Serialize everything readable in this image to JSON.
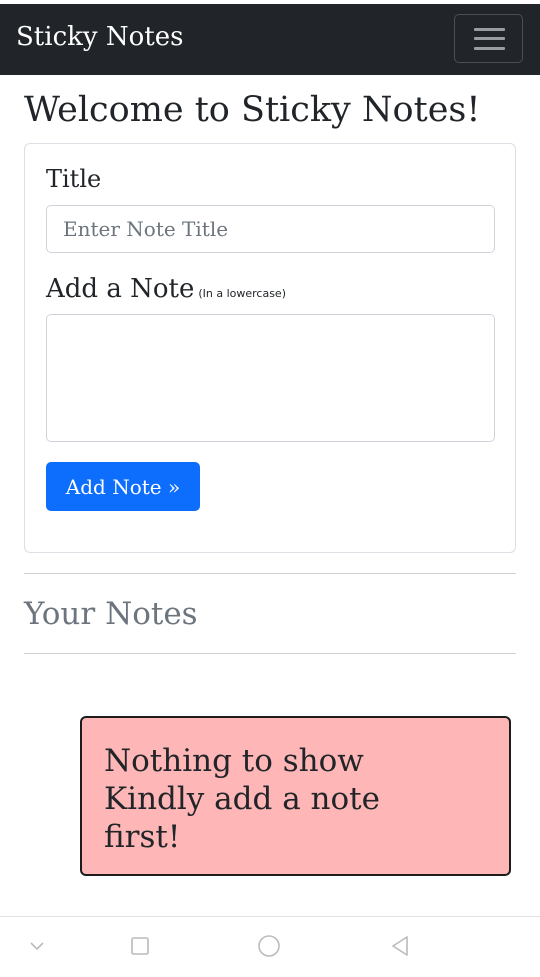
{
  "navbar": {
    "brand": "Sticky Notes"
  },
  "page": {
    "title": "Welcome to Sticky Notes!"
  },
  "form": {
    "title_label": "Title",
    "title_placeholder": "Enter Note Title",
    "title_value": "",
    "note_label": "Add a Note",
    "note_hint": "(In a lowercase)",
    "note_value": "",
    "add_button": "Add Note »"
  },
  "notes": {
    "heading": "Your Notes",
    "empty_lines": [
      "Nothing to show",
      "Kindly add a note",
      "first!"
    ],
    "empty_bg_color": "#ffb6b6"
  },
  "colors": {
    "navbar_bg": "#212529",
    "primary": "#0d6efd",
    "muted": "#6c757d"
  },
  "system_nav": {
    "icons": [
      "chevron-down-icon",
      "square-icon",
      "circle-icon",
      "back-triangle-icon"
    ]
  }
}
